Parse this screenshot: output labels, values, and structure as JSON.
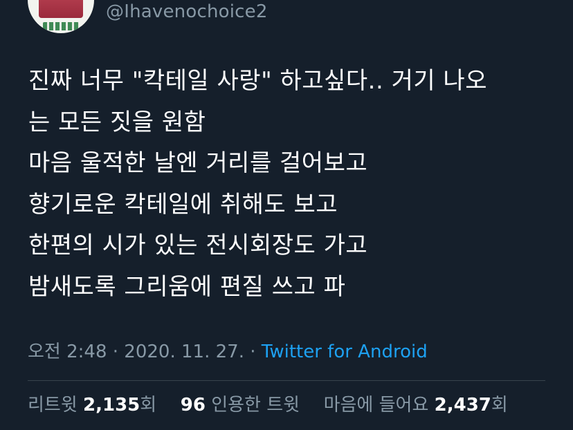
{
  "author": {
    "handle": "@Ihavenochoice2"
  },
  "tweet": {
    "lines": [
      "진짜 너무 \"칵테일 사랑\" 하고싶다.. 거기 나오",
      "는 모든 짓을 원함",
      "마음 울적한 날엔 거리를 걸어보고",
      "향기로운 칵테일에 취해도 보고",
      "한편의 시가 있는 전시회장도 가고",
      "밤새도록 그리움에 편질 쓰고 파"
    ],
    "time": "오전 2:48",
    "date": "2020. 11. 27.",
    "separator": "·",
    "source": "Twitter for Android"
  },
  "stats": {
    "retweets_label": "리트윗",
    "retweets_count": "2,135",
    "retweets_unit": "회",
    "quotes_count": "96",
    "quotes_label": "인용한 트윗",
    "likes_label": "마음에 들어요",
    "likes_count": "2,437",
    "likes_unit": "회"
  },
  "colors": {
    "background": "#151f2b",
    "text": "#ffffff",
    "secondary": "#8899a6",
    "link": "#1da1f2",
    "divider": "#38444d"
  }
}
